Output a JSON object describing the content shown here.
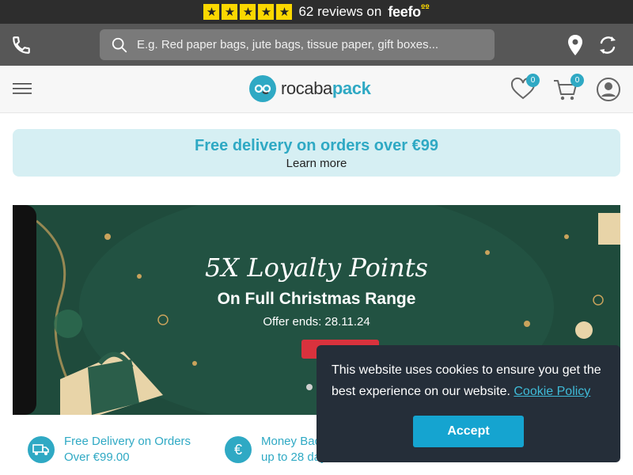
{
  "rating_bar": {
    "stars": 5,
    "reviews_text": "62 reviews on",
    "brand": "feefo",
    "brand_mark": "ºº"
  },
  "search_bar": {
    "placeholder": "E.g. Red paper bags, jute bags, tissue paper, gift boxes..."
  },
  "header": {
    "logo_part1": "rocaba",
    "logo_part2": "pack",
    "wishlist_count": "0",
    "cart_count": "0"
  },
  "promo": {
    "title": "Free delivery on orders over €99",
    "link": "Learn more"
  },
  "hero": {
    "title": "5X Loyalty Points",
    "subtitle": "On Full Christmas Range",
    "offer": "Offer ends: 28.11.24",
    "cta": "Shop Now",
    "active_slide": 1
  },
  "features": [
    {
      "icon": "delivery-truck-icon",
      "line1": "Free Delivery on Orders",
      "line2": "Over €99.00"
    },
    {
      "icon": "euro-icon",
      "line1": "Money Back",
      "line2": "up to 28 days"
    }
  ],
  "cookie": {
    "message": "This website uses cookies to ensure you get the best experience on our website.",
    "link": "Cookie Policy",
    "accept": "Accept"
  },
  "colors": {
    "accent": "#2fa9c4",
    "topbar": "#2d2d2d",
    "searchbar": "#575757",
    "hero_bg": "#1f4b3c",
    "cookie_bg": "#252e39",
    "accept_btn": "#15a4d0"
  }
}
